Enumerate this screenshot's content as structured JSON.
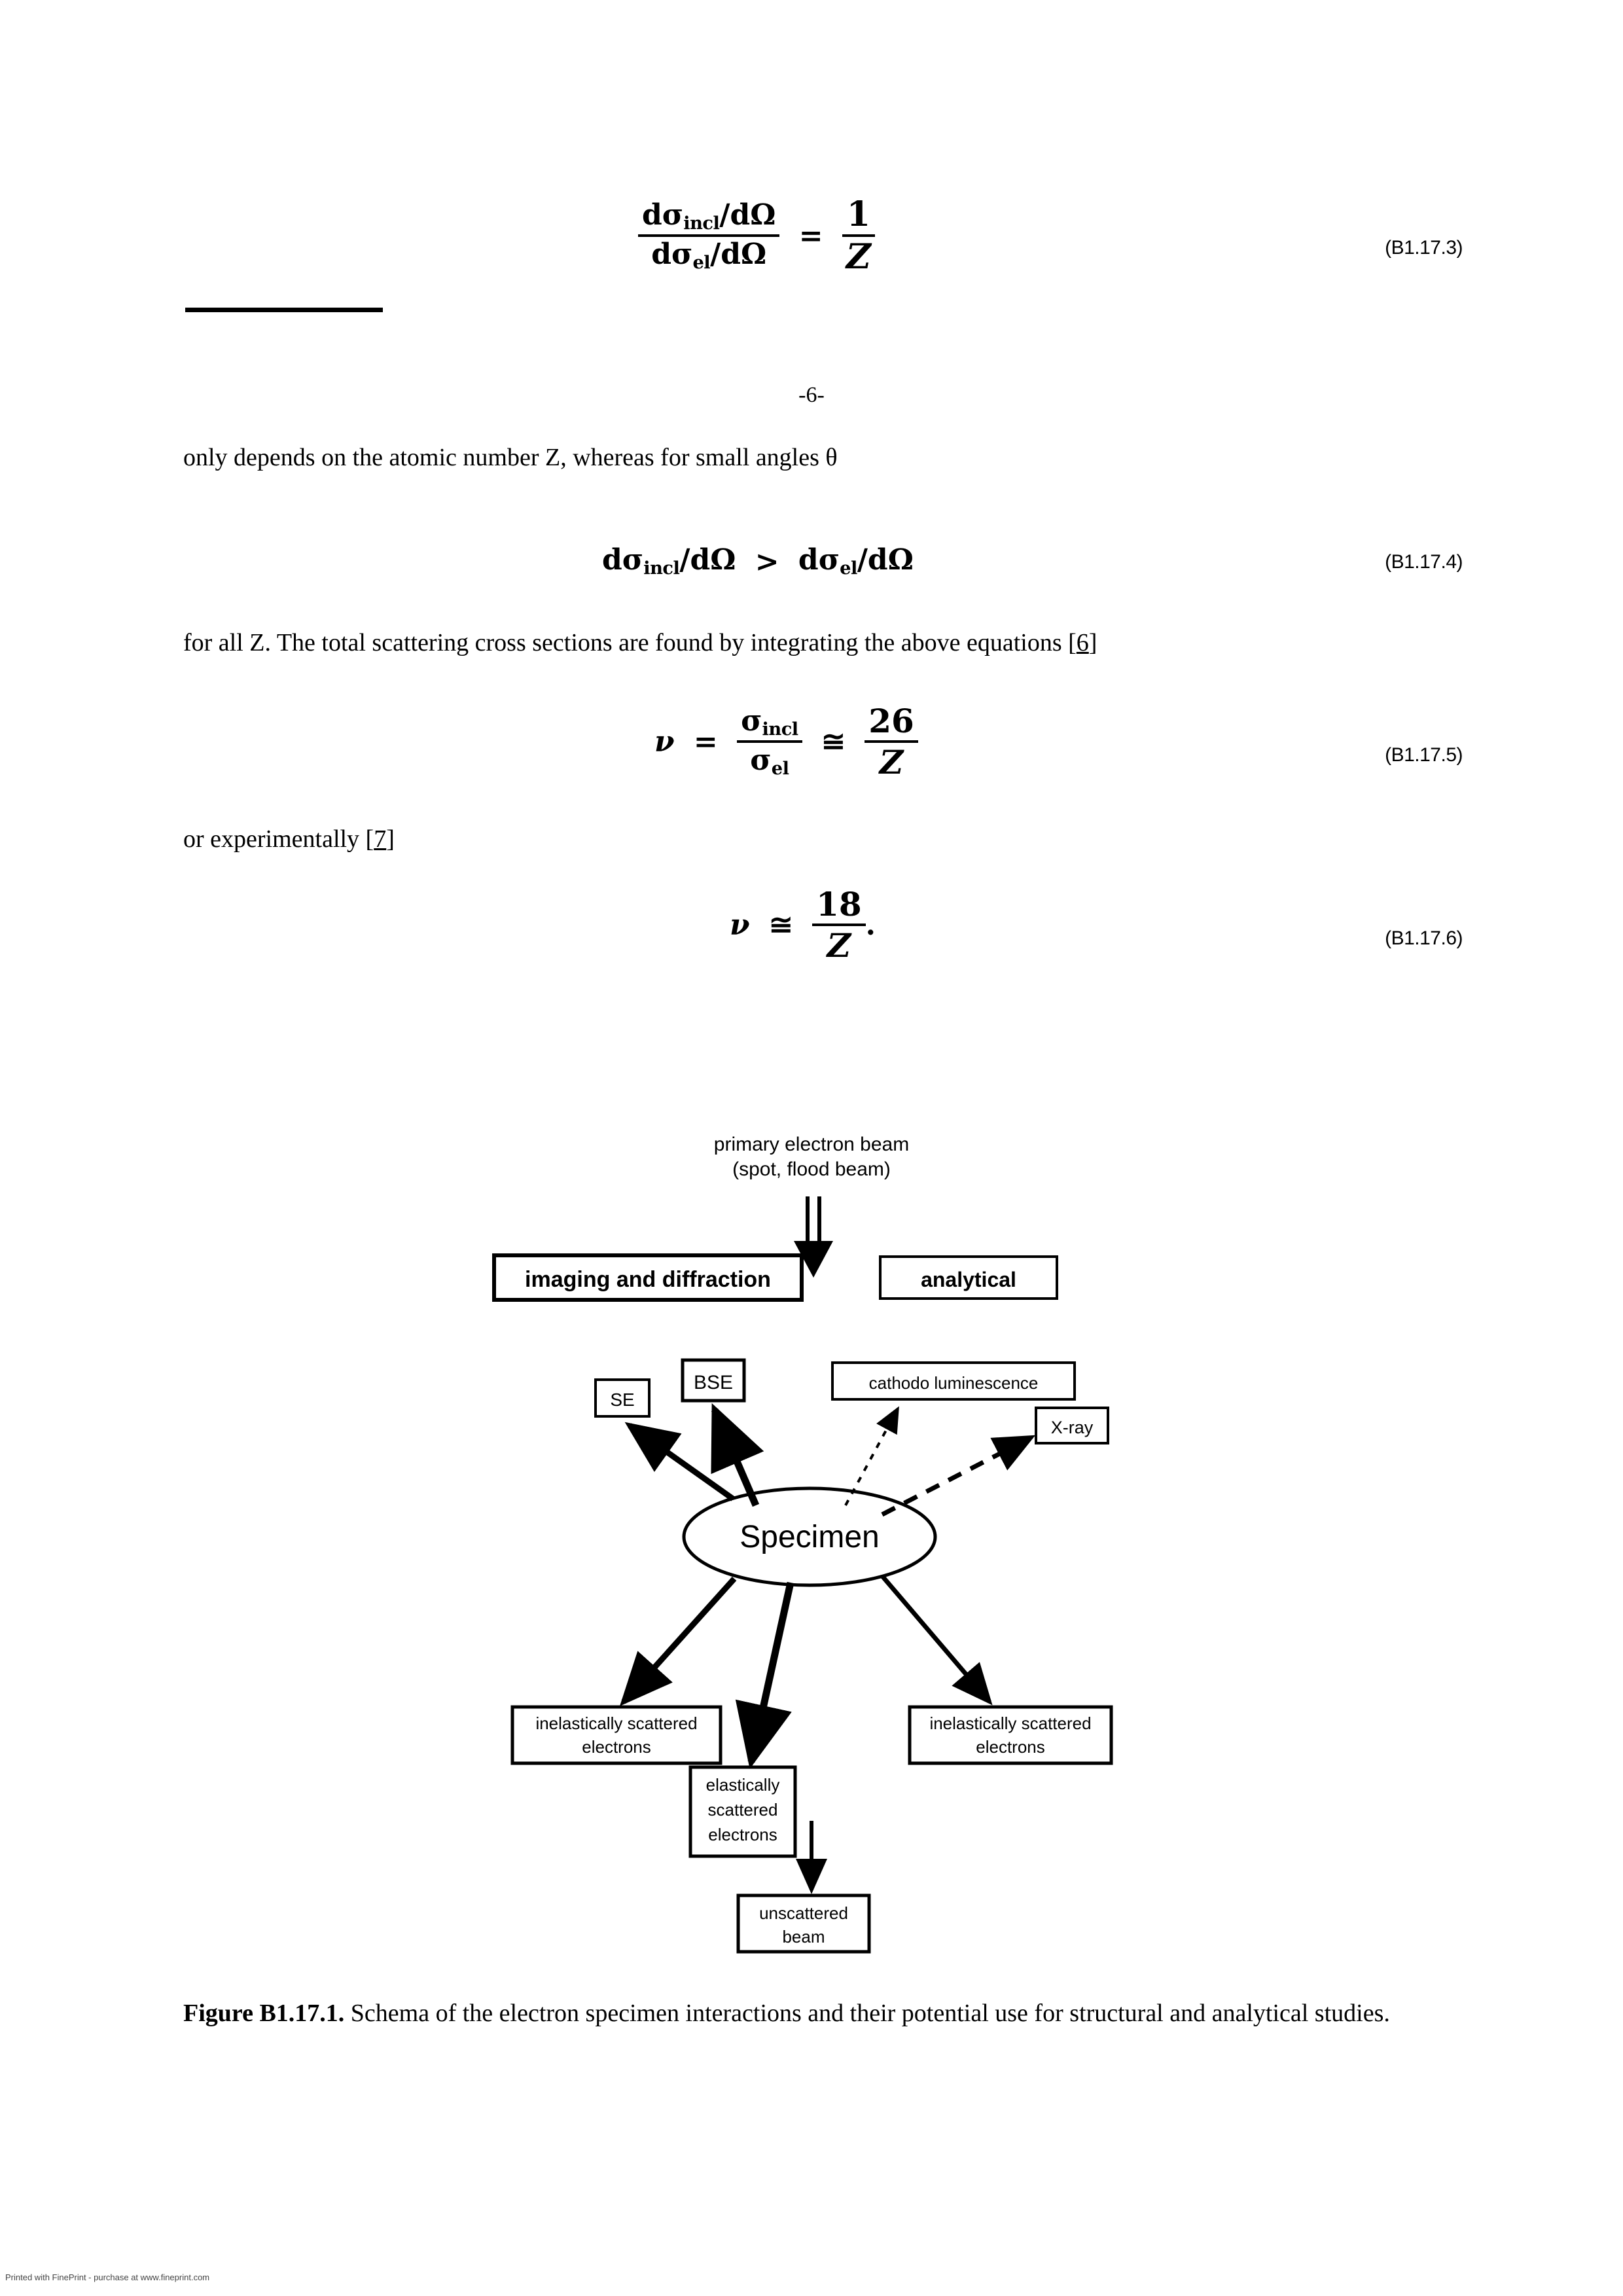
{
  "page": {
    "number_label": "-6-",
    "footer_note": "Printed with FinePrint - purchase at www.fineprint.com"
  },
  "equations": [
    {
      "id": "B1.17.3",
      "tag": "(B1.17.3)",
      "numerator": "dσ",
      "numerator_sub": "incl",
      "numerator_tail": "/dΩ",
      "denominator": "dσ",
      "denominator_sub": "el",
      "denominator_tail": "/dΩ",
      "operator": "=",
      "rhs_num": "1",
      "rhs_den": "Z"
    },
    {
      "id": "B1.17.4",
      "tag": "(B1.17.4)",
      "lhs": "dσ",
      "lhs_sub": "incl",
      "lhs_tail": "/dΩ",
      "operator": ">",
      "rhs": "dσ",
      "rhs_sub": "el",
      "rhs_tail": "/dΩ"
    },
    {
      "id": "B1.17.5",
      "tag": "(B1.17.5)",
      "lhs_var": "ν",
      "operator1": "=",
      "numerator": "σ",
      "numerator_sub": "incl",
      "denominator": "σ",
      "denominator_sub": "el",
      "operator2": "≅",
      "rhs_num": "26",
      "rhs_den": "Z"
    },
    {
      "id": "B1.17.6",
      "tag": "(B1.17.6)",
      "lhs_var": "ν",
      "operator": "≅",
      "rhs_num": "18",
      "rhs_den": "Z",
      "trailing": "."
    }
  ],
  "paragraphs": {
    "line1": "only depends on the atomic number Z, whereas for small angles θ",
    "line2_pre": "for all Z. The total scattering cross sections are found by integrating the above equations [",
    "line2_ref": "6",
    "line2_post": "]",
    "line3_pre": "or experimentally [",
    "line3_ref": "7",
    "line3_post": "]"
  },
  "figure": {
    "caption_label": "Figure B1.17.1.",
    "caption_text": " Schema of the electron specimen interactions and their potential use for structural and analytical studies.",
    "beam_label_line1": "primary electron beam",
    "beam_label_line2": "(spot, flood beam)",
    "category_imaging": "imaging and diffraction",
    "category_analytical": "analytical",
    "box_se": "SE",
    "box_bse": "BSE",
    "box_cathodo": "cathodo luminescence",
    "box_xray": "X-ray",
    "specimen": "Specimen",
    "box_inelastic_left_line1": "inelastically scattered",
    "box_inelastic_left_line2": "electrons",
    "box_inelastic_right_line1": "inelastically scattered",
    "box_inelastic_right_line2": "electrons",
    "box_elastic_line1": "elastically",
    "box_elastic_line2": "scattered",
    "box_elastic_line3": "electrons",
    "box_unscattered_line1": "unscattered",
    "box_unscattered_line2": "beam"
  },
  "colors": {
    "ink": "#000000",
    "paper": "#ffffff"
  }
}
